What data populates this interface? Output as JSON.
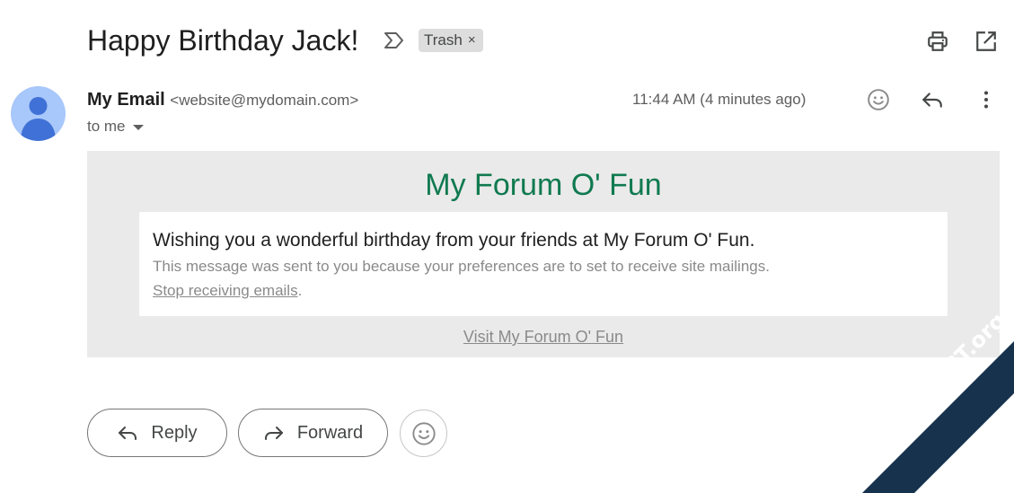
{
  "header": {
    "subject": "Happy Birthday Jack!",
    "label_chip": "Trash",
    "label_chip_remove": "×",
    "icons": [
      "label-important-icon",
      "print-icon",
      "open-in-new-window-icon"
    ]
  },
  "message": {
    "sender_name": "My Email",
    "sender_address": "<website@mydomain.com>",
    "recipient": "to me",
    "timestamp": "11:44 AM (4 minutes ago)",
    "icons": [
      "avatar-person-icon",
      "emoji-reaction-icon",
      "reply-icon",
      "more-vert-icon"
    ]
  },
  "body": {
    "forum_title": "My Forum O' Fun",
    "wish_text": "Wishing you a wonderful birthday from your friends at My Forum O' Fun.",
    "notice_text": "This message was sent to you because your preferences are to set to receive site mailings.",
    "stop_link": "Stop receiving emails",
    "stop_suffix": ".",
    "visit_link": "Visit My Forum O' Fun",
    "title_color": "#107a50"
  },
  "actions": {
    "reply_label": "Reply",
    "forward_label": "Forward"
  },
  "watermark": {
    "text": "TeamDGT.org",
    "color": "#17324d"
  }
}
